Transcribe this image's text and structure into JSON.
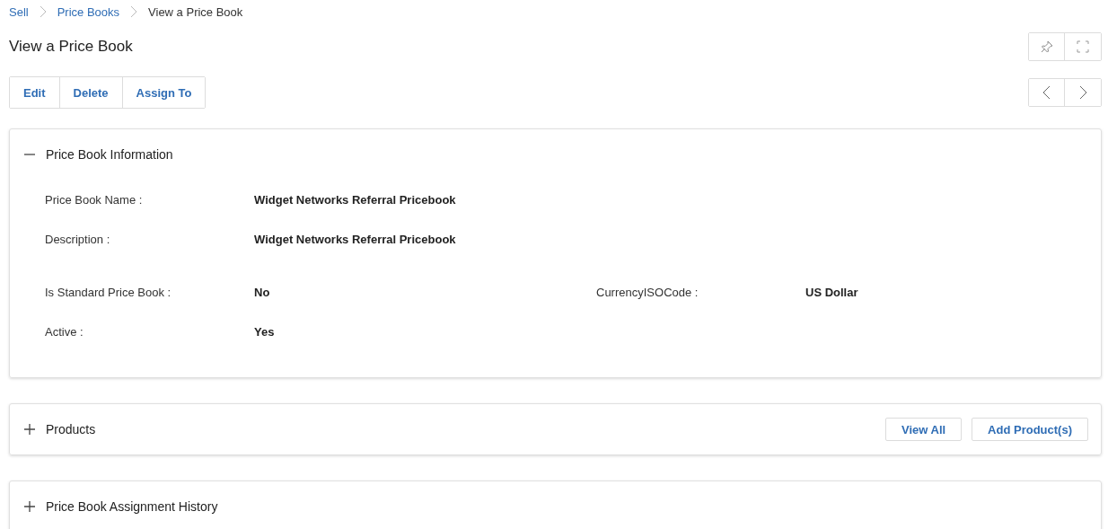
{
  "breadcrumb": [
    {
      "label": "Sell",
      "link": true
    },
    {
      "label": "Price Books",
      "link": true
    },
    {
      "label": "View a Price Book",
      "link": false
    }
  ],
  "title": "View a Price Book",
  "actions": [
    "Edit",
    "Delete",
    "Assign To"
  ],
  "sections": [
    {
      "title": "Price Book Information",
      "expanded": true,
      "groups": [
        [
          [
            {
              "label": "Price Book Name :",
              "value": "Widget Networks Referral Pricebook"
            }
          ],
          [
            {
              "label": "Description :",
              "value": "Widget Networks Referral Pricebook"
            }
          ]
        ],
        [
          [
            {
              "label": "Is Standard Price Book :",
              "value": "No"
            },
            {
              "label": "CurrencyISOCode :",
              "value": "US Dollar"
            }
          ],
          [
            {
              "label": "Active :",
              "value": "Yes"
            }
          ]
        ]
      ]
    },
    {
      "title": "Products",
      "expanded": false,
      "buttons": [
        "View All",
        "Add Product(s)"
      ]
    },
    {
      "title": "Price Book Assignment History",
      "expanded": false
    }
  ]
}
